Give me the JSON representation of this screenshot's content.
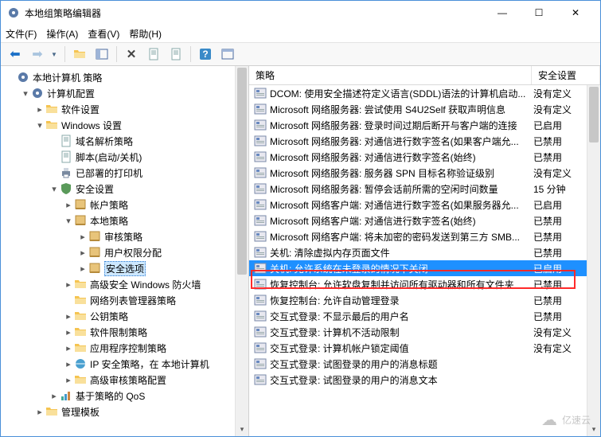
{
  "window": {
    "title": "本地组策略编辑器",
    "controls": {
      "minimize": "—",
      "maximize": "☐",
      "close": "✕"
    }
  },
  "menu": {
    "file": "文件(F)",
    "action": "操作(A)",
    "view": "查看(V)",
    "help": "帮助(H)"
  },
  "tree": [
    {
      "lvl": 0,
      "twist": "",
      "icon": "gear",
      "label": "本地计算机 策略",
      "sel": false
    },
    {
      "lvl": 1,
      "twist": "▾",
      "icon": "gear",
      "label": "计算机配置",
      "sel": false
    },
    {
      "lvl": 2,
      "twist": "▸",
      "icon": "folder",
      "label": "软件设置",
      "sel": false
    },
    {
      "lvl": 2,
      "twist": "▾",
      "icon": "folder",
      "label": "Windows 设置",
      "sel": false
    },
    {
      "lvl": 3,
      "twist": "",
      "icon": "page",
      "label": "域名解析策略",
      "sel": false
    },
    {
      "lvl": 3,
      "twist": "",
      "icon": "page",
      "label": "脚本(启动/关机)",
      "sel": false
    },
    {
      "lvl": 3,
      "twist": "",
      "icon": "printer",
      "label": "已部署的打印机",
      "sel": false
    },
    {
      "lvl": 3,
      "twist": "▾",
      "icon": "shield",
      "label": "安全设置",
      "sel": false
    },
    {
      "lvl": 4,
      "twist": "▸",
      "icon": "book",
      "label": "帐户策略",
      "sel": false
    },
    {
      "lvl": 4,
      "twist": "▾",
      "icon": "book",
      "label": "本地策略",
      "sel": false
    },
    {
      "lvl": 5,
      "twist": "▸",
      "icon": "book",
      "label": "审核策略",
      "sel": false
    },
    {
      "lvl": 5,
      "twist": "▸",
      "icon": "book",
      "label": "用户权限分配",
      "sel": false
    },
    {
      "lvl": 5,
      "twist": "▸",
      "icon": "book",
      "label": "安全选项",
      "sel": true
    },
    {
      "lvl": 4,
      "twist": "▸",
      "icon": "folder",
      "label": "高级安全 Windows 防火墙",
      "sel": false
    },
    {
      "lvl": 4,
      "twist": "",
      "icon": "folder",
      "label": "网络列表管理器策略",
      "sel": false
    },
    {
      "lvl": 4,
      "twist": "▸",
      "icon": "folder",
      "label": "公钥策略",
      "sel": false
    },
    {
      "lvl": 4,
      "twist": "▸",
      "icon": "folder",
      "label": "软件限制策略",
      "sel": false
    },
    {
      "lvl": 4,
      "twist": "▸",
      "icon": "folder",
      "label": "应用程序控制策略",
      "sel": false
    },
    {
      "lvl": 4,
      "twist": "▸",
      "icon": "ie",
      "label": "IP 安全策略，在 本地计算机",
      "sel": false
    },
    {
      "lvl": 4,
      "twist": "▸",
      "icon": "folder",
      "label": "高级审核策略配置",
      "sel": false
    },
    {
      "lvl": 3,
      "twist": "▸",
      "icon": "bars",
      "label": "基于策略的 QoS",
      "sel": false
    },
    {
      "lvl": 2,
      "twist": "▸",
      "icon": "folder",
      "label": "管理模板",
      "sel": false
    }
  ],
  "columns": {
    "policy": "策略",
    "setting": "安全设置"
  },
  "rows": [
    {
      "label": "DCOM: 使用安全描述符定义语言(SDDL)语法的计算机启动...",
      "setting": "没有定义",
      "sel": false
    },
    {
      "label": "Microsoft 网络服务器: 尝试使用 S4U2Self 获取声明信息",
      "setting": "没有定义",
      "sel": false
    },
    {
      "label": "Microsoft 网络服务器: 登录时间过期后断开与客户端的连接",
      "setting": "已启用",
      "sel": false
    },
    {
      "label": "Microsoft 网络服务器: 对通信进行数字签名(如果客户端允...",
      "setting": "已禁用",
      "sel": false
    },
    {
      "label": "Microsoft 网络服务器: 对通信进行数字签名(始终)",
      "setting": "已禁用",
      "sel": false
    },
    {
      "label": "Microsoft 网络服务器: 服务器 SPN 目标名称验证级别",
      "setting": "没有定义",
      "sel": false
    },
    {
      "label": "Microsoft 网络服务器: 暂停会话前所需的空闲时间数量",
      "setting": "15 分钟",
      "sel": false
    },
    {
      "label": "Microsoft 网络客户端: 对通信进行数字签名(如果服务器允...",
      "setting": "已启用",
      "sel": false
    },
    {
      "label": "Microsoft 网络客户端: 对通信进行数字签名(始终)",
      "setting": "已禁用",
      "sel": false
    },
    {
      "label": "Microsoft 网络客户端: 将未加密的密码发送到第三方 SMB...",
      "setting": "已禁用",
      "sel": false
    },
    {
      "label": "关机: 清除虚拟内存页面文件",
      "setting": "已禁用",
      "sel": false
    },
    {
      "label": "关机: 允许系统在未登录的情况下关闭",
      "setting": "已启用",
      "sel": true
    },
    {
      "label": "恢复控制台: 允许软盘复制并访问所有驱动器和所有文件夹",
      "setting": "已禁用",
      "sel": false
    },
    {
      "label": "恢复控制台: 允许自动管理登录",
      "setting": "已禁用",
      "sel": false
    },
    {
      "label": "交互式登录: 不显示最后的用户名",
      "setting": "已禁用",
      "sel": false
    },
    {
      "label": "交互式登录: 计算机不活动限制",
      "setting": "没有定义",
      "sel": false
    },
    {
      "label": "交互式登录: 计算机帐户锁定阈值",
      "setting": "没有定义",
      "sel": false
    },
    {
      "label": "交互式登录: 试图登录的用户的消息标题",
      "setting": "",
      "sel": false
    },
    {
      "label": "交互式登录: 试图登录的用户的消息文本",
      "setting": "",
      "sel": false
    }
  ],
  "watermark": "亿速云"
}
